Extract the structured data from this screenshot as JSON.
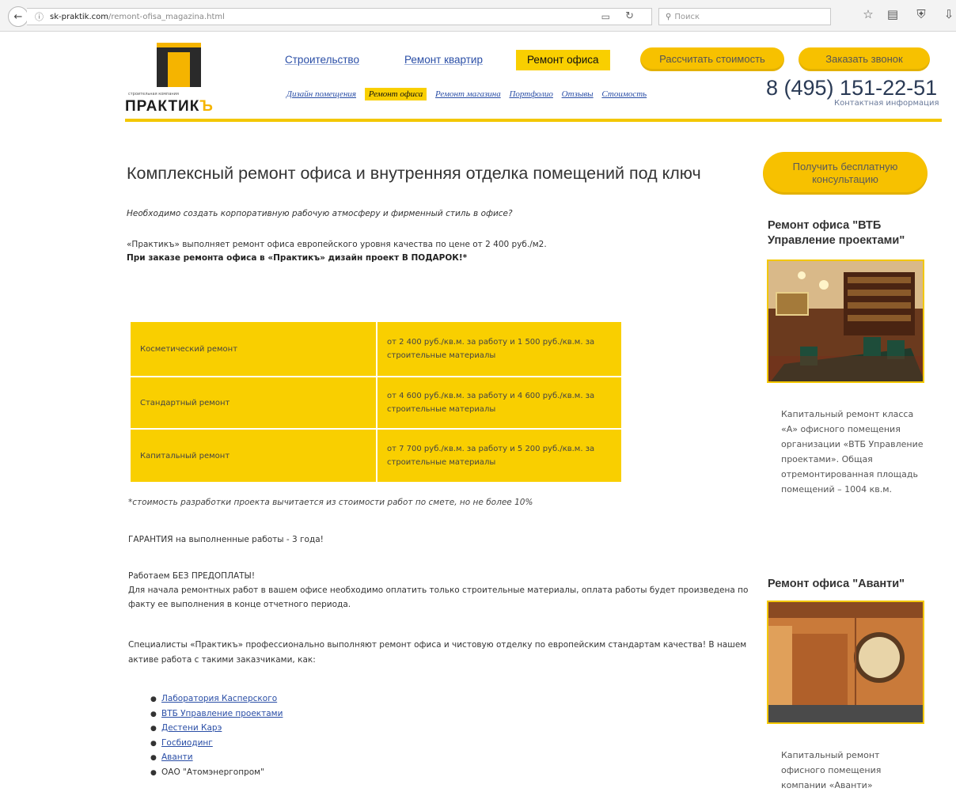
{
  "browser": {
    "url_host": "sk-praktik.com",
    "url_path": "/remont-ofisa_magazina.html",
    "search_placeholder": "Поиск"
  },
  "logo": {
    "tagline": "строительная компания",
    "wordmark": "ПРАКТИК",
    "wordmark_sign": "Ъ"
  },
  "nav": {
    "items": [
      {
        "label": "Строительство"
      },
      {
        "label": "Ремонт квартир"
      },
      {
        "label": "Ремонт офиса"
      }
    ],
    "calc_button": "Рассчитать стоимость",
    "callback_button": "Заказать звонок",
    "sub_items": [
      {
        "label": "Дизайн помещения"
      },
      {
        "label": "Ремонт офиса"
      },
      {
        "label": "Ремонт магазина"
      },
      {
        "label": "Портфолио"
      },
      {
        "label": "Отзывы"
      },
      {
        "label": "Стоимость"
      }
    ]
  },
  "contact": {
    "phone": "8 (495) 151-22-51",
    "contacts_link": "Контактная информация"
  },
  "main": {
    "title": "Комплексный ремонт офиса и внутренняя отделка помещений под ключ",
    "lead": "Необходимо создать корпоративную рабочую атмосферу и фирменный стиль в офисе?",
    "intro": "«Практикъ» выполняет ремонт офиса европейского уровня качества по цене от 2 400 руб./м2.",
    "promo": "При заказе ремонта офиса в «Практикъ» дизайн проект В ПОДАРОК!*",
    "prices": [
      {
        "type": "Косметический ремонт",
        "price": "от 2 400 руб./кв.м. за работу и 1 500 руб./кв.м. за строительные материалы"
      },
      {
        "type": "Стандартный ремонт",
        "price": "от 4 600 руб./кв.м. за работу и 4 600 руб./кв.м. за строительные материалы"
      },
      {
        "type": "Капитальный ремонт",
        "price": "от 7 700 руб./кв.м. за работу и 5 200 руб./кв.м. за строительные материалы"
      }
    ],
    "note": "*стоимость разработки проекта вычитается из стоимости работ по смете, но не более 10%",
    "guarantee": "ГАРАНТИЯ на выполненные работы - 3 года!",
    "noprepay_title": "Работаем БЕЗ ПРЕДОПЛАТЫ!",
    "noprepay_text": "Для начала ремонтных работ в вашем офисе необходимо оплатить только строительные материалы, оплата работы будет произведена по факту ее выполнения в конце отчетного периода.",
    "specialists": "Специалисты «Практикъ» профессионально выполняют ремонт офиса и чистовую отделку по европейским стандартам качества! В нашем активе работа с такими заказчиками, как:",
    "clients": [
      {
        "name": "Лаборатория Касперского",
        "link": true
      },
      {
        "name": "ВТБ Управление проектами",
        "link": true
      },
      {
        "name": "Дестени Карэ",
        "link": true
      },
      {
        "name": "Госбиодинг",
        "link": true
      },
      {
        "name": "Аванти",
        "link": true
      },
      {
        "name": "ОАО \"Атомэнергопром\"",
        "link": false
      }
    ]
  },
  "sidebar": {
    "cta": "Получить бесплатную консультацию",
    "projects": [
      {
        "title": "Ремонт офиса \"ВТБ Управление проектами\"",
        "description": "Капитальный ремонт класса «А» офисного помещения организации «ВТБ Управление проектами». Общая отремонтированная площадь помещений – 1004 кв.м."
      },
      {
        "title": "Ремонт офиса \"Аванти\"",
        "description": "Капитальный ремонт офисного помещения компании «Аванти»"
      }
    ]
  },
  "colors": {
    "accent": "#f9cf00",
    "button": "#f7c100",
    "link": "#2a4ea6"
  }
}
